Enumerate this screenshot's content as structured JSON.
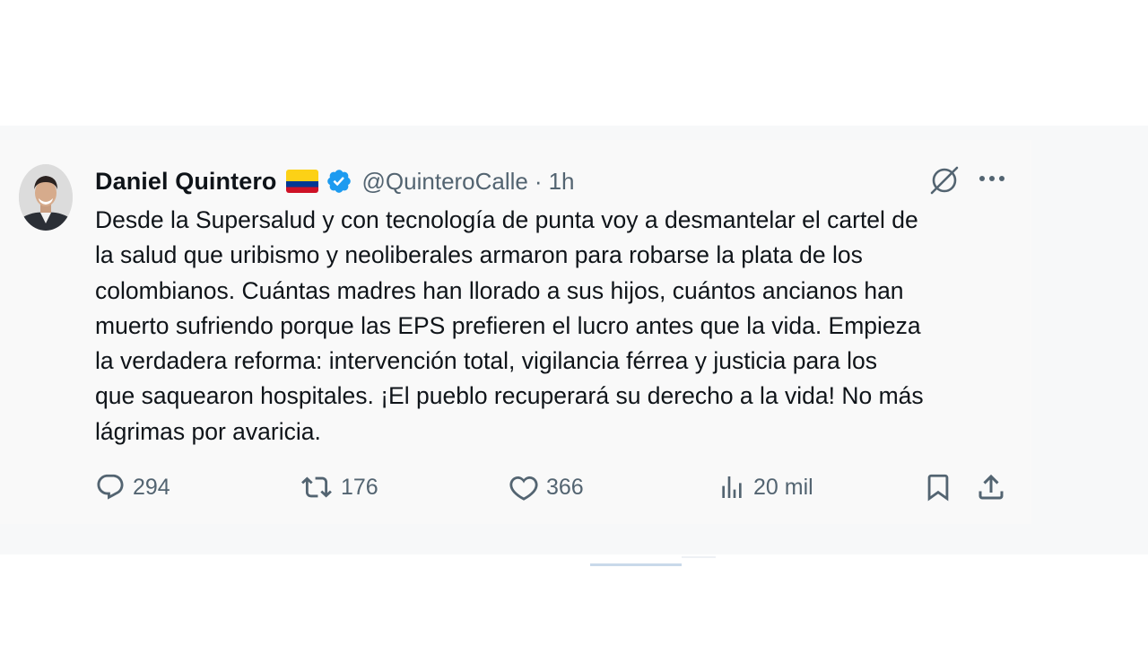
{
  "tweet": {
    "author_name": "Daniel Quintero",
    "flag_emoji": "colombia-flag",
    "handle": "@QuinteroCalle",
    "separator": "·",
    "time": "1h",
    "text_lines": [
      "Desde la Supersalud y con tecnología de punta voy a desmantelar el cartel de",
      "la salud que uribismo y neoliberales armaron para robarse la plata de los",
      "colombianos. Cuántas madres han llorado a sus hijos, cuántos ancianos han",
      "muerto sufriendo porque las EPS prefieren el lucro antes que la vida. Empieza",
      "la verdadera reforma: intervención total, vigilancia férrea y justicia para los",
      "que saquearon hospitales. ¡El pueblo recuperará su derecho a la vida! No más",
      "lágrimas por avaricia."
    ]
  },
  "actions": {
    "replies": "294",
    "reposts": "176",
    "likes": "366",
    "views": "20 mil"
  },
  "colors": {
    "verified_blue": "#1d9bf0",
    "text_primary": "#0f1419",
    "text_secondary": "#536471",
    "icon_gray": "#536471"
  },
  "icons": {
    "reply": "reply-icon",
    "repost": "repost-icon",
    "like": "heart-icon",
    "views": "views-icon",
    "bookmark": "bookmark-icon",
    "share": "share-icon",
    "grok": "grok-icon",
    "more": "more-icon",
    "verified": "verified-badge-icon"
  }
}
